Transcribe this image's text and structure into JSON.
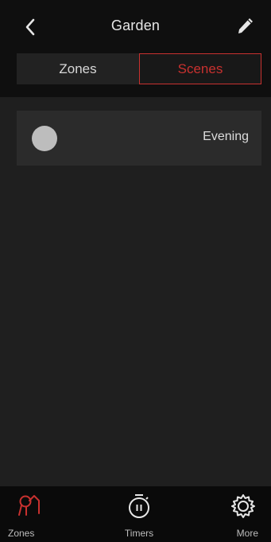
{
  "header": {
    "title": "Garden"
  },
  "segments": {
    "zones_label": "Zones",
    "scenes_label": "Scenes",
    "selected": "Scenes"
  },
  "scenes": [
    {
      "name": "Evening"
    }
  ],
  "tabbar": {
    "zones_label": "Zones",
    "timers_label": "Timers",
    "more_label": "More",
    "active": "Zones"
  },
  "colors": {
    "accent": "#c8312f",
    "header_bg": "#0f0f0f",
    "content_bg": "#1f1f1f",
    "row_bg": "#2b2b2b",
    "tabbar_bg": "#0a0a0a"
  }
}
